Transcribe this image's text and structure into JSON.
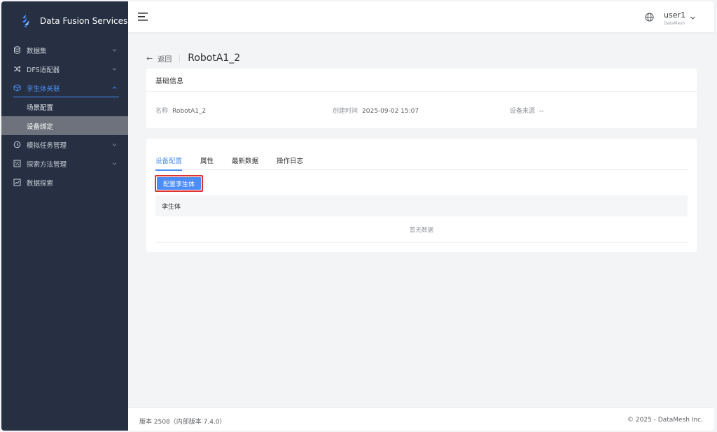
{
  "app": {
    "brand": "Data Fusion Services"
  },
  "sidebar": {
    "items": [
      {
        "label": "数据集",
        "icon": "database-icon",
        "expandable": true
      },
      {
        "label": "DFS适配器",
        "icon": "shuffle-icon",
        "expandable": true
      },
      {
        "label": "孪生体关联",
        "icon": "cube-icon",
        "expandable": true,
        "expanded": true,
        "children": [
          {
            "label": "场景配置"
          },
          {
            "label": "设备绑定",
            "selected": true
          }
        ]
      },
      {
        "label": "模拟任务管理",
        "icon": "task-clock-icon",
        "expandable": true
      },
      {
        "label": "探索方法管理",
        "icon": "percent-box-icon",
        "expandable": true
      },
      {
        "label": "数据探索",
        "icon": "chart-box-icon",
        "expandable": false
      }
    ]
  },
  "header": {
    "user": "user1",
    "org": "DataMesh"
  },
  "breadcrumb": {
    "back": "返回",
    "title": "RobotA1_2"
  },
  "basic": {
    "title": "基础信息",
    "name_label": "名称",
    "name_value": "RobotA1_2",
    "created_label": "创建时间",
    "created_value": "2025-09-02 15:07",
    "source_label": "设备来源",
    "source_value": "--"
  },
  "tabs": [
    {
      "label": "设备配置",
      "active": true
    },
    {
      "label": "属性"
    },
    {
      "label": "最新数据"
    },
    {
      "label": "操作日志"
    }
  ],
  "config": {
    "button": "配置孪生体",
    "column": "孪生体",
    "empty": "暂无数据"
  },
  "footer": {
    "version": "版本 2508（内部版本 7.4.0）",
    "copyright": "© 2025 - DataMesh Inc."
  },
  "colors": {
    "accent": "#4b8cf7",
    "sidebar": "#263042",
    "highlight_border": "#e03131"
  }
}
